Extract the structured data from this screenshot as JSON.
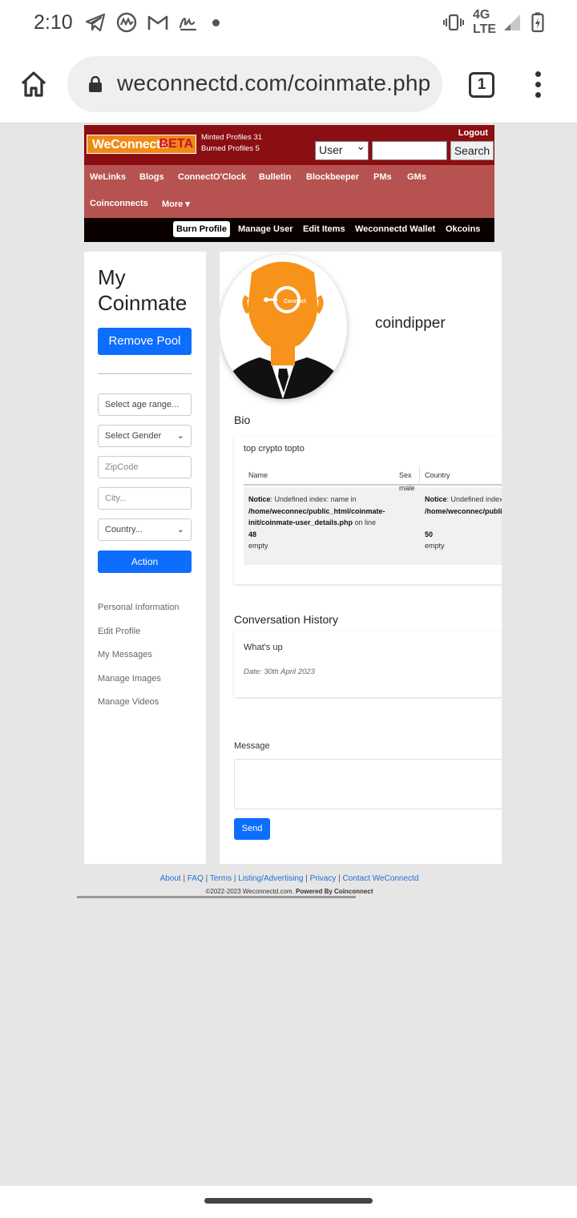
{
  "status_bar": {
    "time": "2:10",
    "network": "4G LTE",
    "icons": [
      "telegram-icon",
      "coinmarketcap-icon",
      "gmail-icon",
      "signature-icon",
      "notification-dot-icon",
      "vibrate-icon",
      "signal-icon",
      "battery-charging-icon"
    ]
  },
  "browser": {
    "url": "weconnectd.com/coinmate.php",
    "tab_count": "1",
    "icons": [
      "home-icon",
      "lock-icon",
      "tabs-icon",
      "more-icon"
    ]
  },
  "site": {
    "logo_text": "WeConnectd",
    "logo_badge": "BETA",
    "minted_profiles": "Minted Profiles 31",
    "burned_profiles": "Burned Profiles 5",
    "logout": "Logout",
    "search_scope": "User",
    "search_query": "",
    "search_button": "Search",
    "nav": [
      "WeLinks",
      "Blogs",
      "ConnectO'Clock",
      "Bulletin",
      "Blockbeeper",
      "PMs",
      "GMs",
      "Coinconnects",
      "More ▾"
    ],
    "subnav": [
      "Burn Profile",
      "Manage User",
      "Edit Items",
      "Weconnectd Wallet",
      "Okcoins"
    ],
    "subnav_active": "Burn Profile",
    "colors": {
      "header_top": "#8b0f12",
      "nav_bg": "#b65351",
      "subnav_bg": "#0a0000",
      "primary": "#0d6efd",
      "logo": "#f08a16"
    }
  },
  "sidebar": {
    "title_line1": "My",
    "title_line2": "Coinmate",
    "remove_pool": "Remove Pool",
    "age_placeholder": "Select age range...",
    "gender_value": "Select Gender",
    "zipcode_placeholder": "ZipCode",
    "city_placeholder": "City...",
    "country_value": "Country...",
    "action_button": "Action",
    "links": [
      "Personal Information",
      "Edit Profile",
      "My Messages",
      "Manage Images",
      "Manage Videos"
    ]
  },
  "profile": {
    "username": "coindipper",
    "avatar_text": "Connect",
    "bio_heading": "Bio",
    "bio_text": "top crypto topto",
    "table_headers": [
      "Name",
      "Sex",
      "Country"
    ],
    "sex": "male",
    "name_notice_label": "Notice",
    "name_notice_msg": ": Undefined index: name in",
    "name_path": "/home/weconnec/public_html/coinmate-init/coinmate-user_details.php",
    "name_online": " on line",
    "name_line": "48",
    "name_empty": "empty",
    "country_notice_label": "Notice",
    "country_notice_msg": ": Undefined index: country in",
    "country_path": "/home/weconnec/public_html/coinmate-init/coinmate-user_details.php",
    "country_line": "50",
    "country_empty": "empty"
  },
  "conversation": {
    "heading": "Conversation History",
    "message": "What's up",
    "date": "Date: 30th April 2023",
    "message_label": "Message",
    "message_value": "",
    "send_button": "Send"
  },
  "footer": {
    "links": [
      "About",
      "FAQ",
      "Terms",
      "Listing/Advertising",
      "Privacy",
      "Contact WeConnectd"
    ],
    "copyright": "©2022-2023 Weconnectd.com.",
    "powered": "Powered By Coinconnect"
  }
}
